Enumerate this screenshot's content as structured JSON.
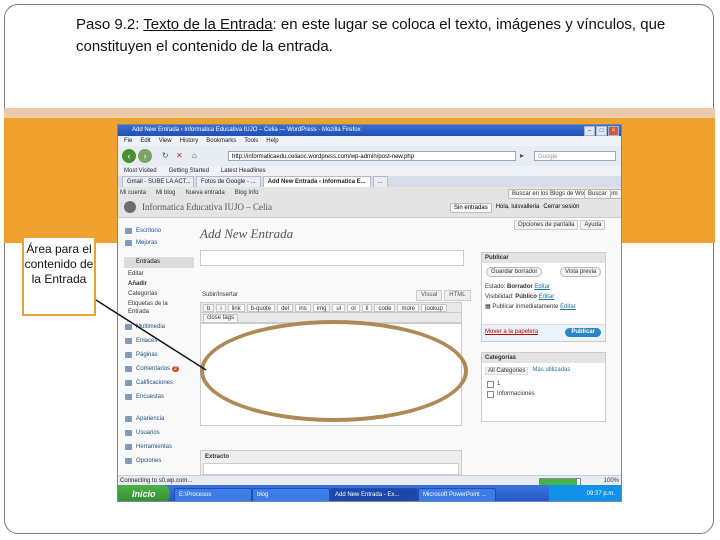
{
  "caption": {
    "prefix": "Paso 9.2: ",
    "link": "Texto de la Entrada",
    "rest": ": en este lugar se coloca el texto, imágenes y vínculos, que constituyen el contenido de la entrada."
  },
  "callout": {
    "text": "Área para el contenido de la Entrada"
  },
  "colors": {
    "band": "#f0a22e",
    "callout_border": "#e7a33a",
    "oval": "#ad8a55"
  },
  "browser": {
    "title": "Add New Entrada ‹ Informatica Educativa IUJO – Celia — WordPress - Mozilla Firefox",
    "menu": [
      "Fie",
      "Edit",
      "View",
      "History",
      "Bookmarks",
      "Tools",
      "Help"
    ],
    "url": "http://informaticaedu.celiaoc.wordpress.com/wp-admin/post-new.php",
    "search_placeholder": "Google",
    "bookmarks": [
      "Most Visited",
      "Getting Started",
      "Latest Headlines"
    ],
    "tabs": [
      "Gmail - SUBE LA ACT...",
      "Fotos de Google - ...",
      "Add New Entrada ‹ Informatica E...",
      "..."
    ],
    "status": "Connecting to s0.wp.com...",
    "zoom": "100%"
  },
  "wp": {
    "favorites": [
      "Mi cuenta",
      "Mi blog",
      "Nueva entrada",
      "Blog Info"
    ],
    "search_posts_btn": "Buscar en los Blogs de WordPress.com",
    "search_btn": "Buscar",
    "blog_name": "Informatica Educativa IUJO – Celia",
    "new_entry_select": "Sin entradas",
    "howdy": "Hola, luisvalleria",
    "logout": "Cerrar sesión",
    "screen_options": [
      "Opciones de pantalla",
      "Ayuda"
    ],
    "sidebar": {
      "dashboard": "Escritorio",
      "upgrades": "Mejoras",
      "entradas_head": "Entradas",
      "entradas_sub": [
        "Editar",
        "Añadir",
        "Categorías",
        "Etiquetas de la Entrada"
      ],
      "media": "Multimedia",
      "links": "Enlaces",
      "pages": "Páginas",
      "comments": "Comentarios",
      "comments_badge": "2",
      "ratings": "Calificaciones",
      "polls": "Encuestas",
      "appearance": "Apariencia",
      "users": "Usuarios",
      "tools": "Herramientas",
      "options": "Opciones"
    },
    "page_title": "Add New Entrada",
    "upload_insert": "Subir/Insertar",
    "editor_tabs": [
      "Visual",
      "HTML"
    ],
    "toolbar_buttons": [
      "b",
      "i",
      "link",
      "b-quote",
      "del",
      "ins",
      "img",
      "ul",
      "ol",
      "li",
      "code",
      "more",
      "lookup"
    ],
    "toolbar2_buttons": [
      "close tags"
    ],
    "extracto": "Extracto",
    "publish": {
      "head": "Publicar",
      "save_draft": "Guardar borrador",
      "preview": "Vista previa",
      "status_label": "Estado:",
      "status_value": "Borrador",
      "status_edit": "Editar",
      "visibility_label": "Visibilidad:",
      "visibility_value": "Público",
      "visibility_edit": "Editar",
      "schedule_label": "Publicar inmediatamente",
      "schedule_edit": "Editar",
      "trash": "Mover a la papelera",
      "publish_btn": "Publicar"
    },
    "categories": {
      "head": "Categorías",
      "tabs": [
        "All Categories",
        "Más utilizadas"
      ],
      "items": [
        "1",
        "Informaciones"
      ]
    }
  },
  "taskbar": {
    "start": "Inicio",
    "tasks": [
      "E:\\Procesos",
      "blog",
      "Add New Entrada - Ex...",
      "Microsoft PowerPoint ..."
    ],
    "time": "09:37 p.m."
  },
  "progress": 0.92
}
